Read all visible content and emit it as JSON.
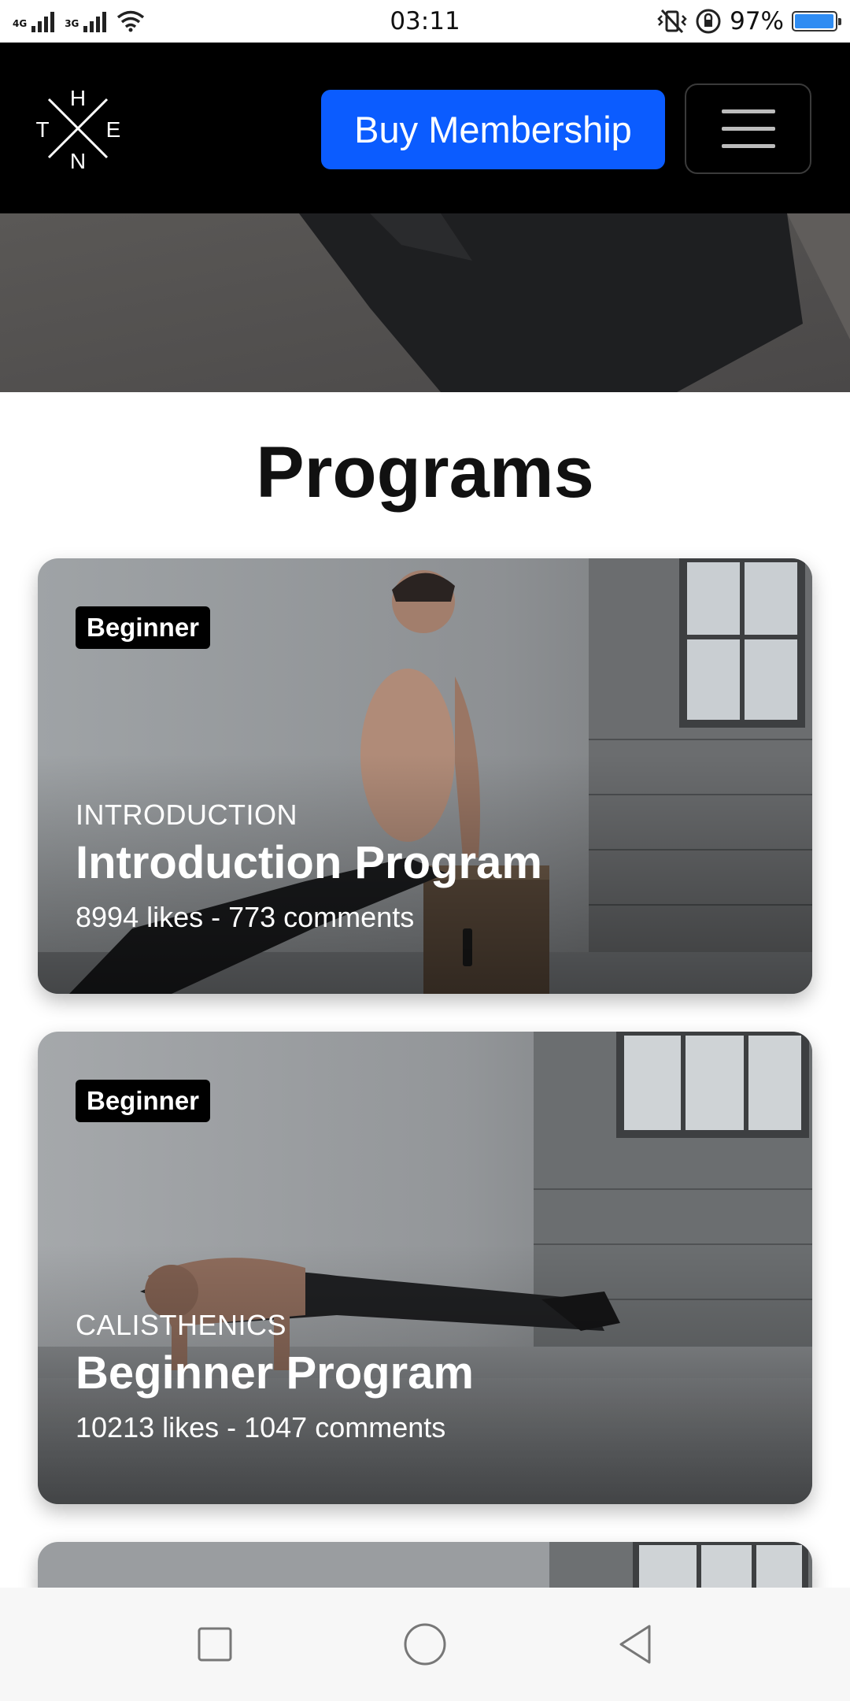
{
  "status_bar": {
    "network_1": "4G",
    "network_2": "3G",
    "time": "03:11",
    "battery_percent": "97%",
    "battery_level": 0.97,
    "icons": [
      "signal-icon",
      "wifi-icon",
      "vibrate-icon",
      "rotation-lock-icon",
      "battery-icon"
    ]
  },
  "header": {
    "logo_letters": {
      "top": "H",
      "left": "T",
      "right": "E",
      "bottom": "N"
    },
    "buy_label": "Buy Membership",
    "menu_icon": "hamburger-icon"
  },
  "section": {
    "title": "Programs"
  },
  "programs": [
    {
      "badge": "Beginner",
      "category": "INTRODUCTION",
      "title": "Introduction Program",
      "stats": "8994 likes - 773 comments"
    },
    {
      "badge": "Beginner",
      "category": "CALISTHENICS",
      "title": "Beginner Program",
      "stats": "10213 likes - 1047 comments"
    }
  ],
  "bottom_nav": {
    "icons": [
      "recent-apps-icon",
      "home-icon",
      "back-icon"
    ]
  },
  "colors": {
    "header_bg": "#000000",
    "accent": "#0b5cff",
    "battery_fill": "#2f8cf2"
  }
}
